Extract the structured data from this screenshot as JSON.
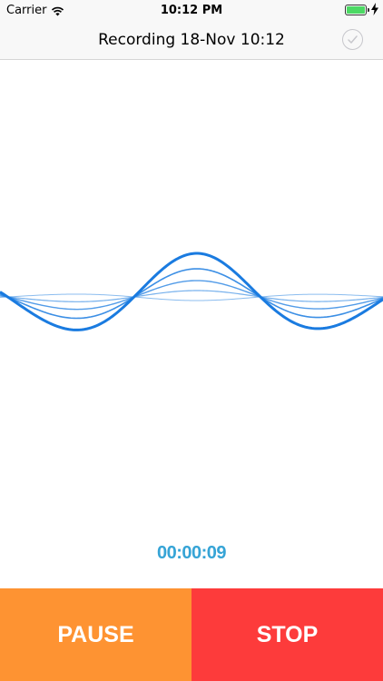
{
  "status_bar": {
    "carrier": "Carrier",
    "time": "10:12 PM",
    "battery_level": 1.0,
    "battery_color": "#4cd964",
    "icons": [
      "wifi-icon",
      "battery-icon",
      "charging-icon"
    ]
  },
  "nav": {
    "title": "Recording 18-Nov 10:12",
    "done_icon": "checkmark-circle-icon"
  },
  "waveform": {
    "color": "#1a7be0",
    "line_count": 5
  },
  "recorder": {
    "elapsed": "00:00:09",
    "timer_color": "#36a4d6"
  },
  "controls": {
    "pause_label": "PAUSE",
    "pause_color": "#fe9332",
    "stop_label": "STOP",
    "stop_color": "#fd3b3b"
  }
}
